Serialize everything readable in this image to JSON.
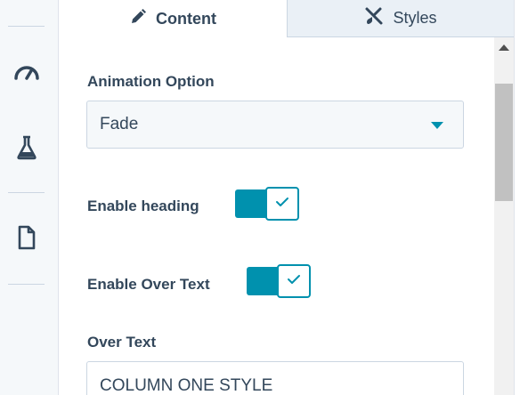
{
  "tabs": [
    {
      "label": "Content",
      "icon": "pencil-icon"
    },
    {
      "label": "Styles",
      "icon": "brush-icon"
    }
  ],
  "sidebar": {
    "icons": [
      "speedometer-icon",
      "flask-icon",
      "document-icon"
    ]
  },
  "fields": {
    "animation": {
      "label": "Animation Option",
      "value": "Fade"
    },
    "enable_heading": {
      "label": "Enable heading",
      "checked": true
    },
    "enable_over_text": {
      "label": "Enable Over Text",
      "checked": true
    },
    "over_text": {
      "label": "Over Text",
      "value": "COLUMN ONE STYLE"
    }
  },
  "colors": {
    "accent": "#0091ae",
    "text": "#33475b",
    "border": "#cbd6e2"
  }
}
